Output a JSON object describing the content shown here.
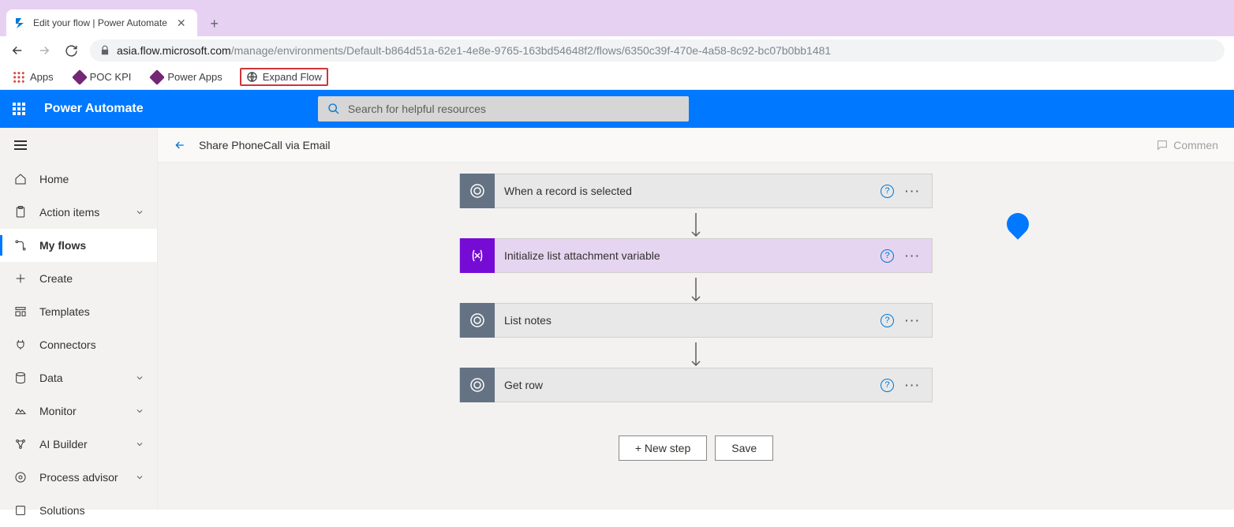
{
  "browser": {
    "tab_title": "Edit your flow | Power Automate",
    "url_host": "asia.flow.microsoft.com",
    "url_path": "/manage/environments/Default-b864d51a-62e1-4e8e-9765-163bd54648f2/flows/6350c39f-470e-4a58-8c92-bc07b0bb1481",
    "bookmarks": {
      "apps": "Apps",
      "poc_kpi": "POC KPI",
      "power_apps": "Power Apps",
      "expand_flow": "Expand Flow"
    }
  },
  "header": {
    "product": "Power Automate",
    "search_placeholder": "Search for helpful resources"
  },
  "sidebar": {
    "items": [
      {
        "label": "Home",
        "icon": "home"
      },
      {
        "label": "Action items",
        "icon": "clipboard",
        "expandable": true
      },
      {
        "label": "My flows",
        "icon": "flow",
        "active": true
      },
      {
        "label": "Create",
        "icon": "plus"
      },
      {
        "label": "Templates",
        "icon": "template"
      },
      {
        "label": "Connectors",
        "icon": "connector"
      },
      {
        "label": "Data",
        "icon": "data",
        "expandable": true
      },
      {
        "label": "Monitor",
        "icon": "monitor",
        "expandable": true
      },
      {
        "label": "AI Builder",
        "icon": "ai",
        "expandable": true
      },
      {
        "label": "Process advisor",
        "icon": "process",
        "expandable": true
      },
      {
        "label": "Solutions",
        "icon": "solutions"
      }
    ]
  },
  "flow": {
    "title": "Share PhoneCall via Email",
    "comments_label": "Commen",
    "steps": [
      {
        "label": "When a record is selected",
        "icon": "cds",
        "variant": "default"
      },
      {
        "label": "Initialize list attachment variable",
        "icon": "var",
        "variant": "purple"
      },
      {
        "label": "List notes",
        "icon": "cds",
        "variant": "default"
      },
      {
        "label": "Get row",
        "icon": "cds",
        "variant": "default"
      }
    ],
    "new_step_label": "+ New step",
    "save_label": "Save"
  }
}
